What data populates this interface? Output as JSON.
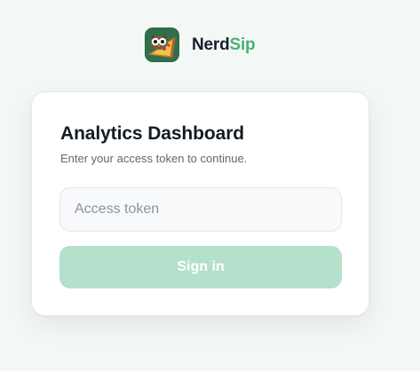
{
  "brand": {
    "name_primary": "Nerd",
    "name_accent": "Sip",
    "logo_icon": "owl-pizza-logo",
    "accent_color": "#4caf74"
  },
  "login": {
    "title": "Analytics Dashboard",
    "subtitle": "Enter your access token to continue.",
    "token_placeholder": "Access token",
    "token_value": "",
    "signin_label": "Sign in",
    "signin_enabled": false,
    "button_color": "#b5e0cb"
  }
}
